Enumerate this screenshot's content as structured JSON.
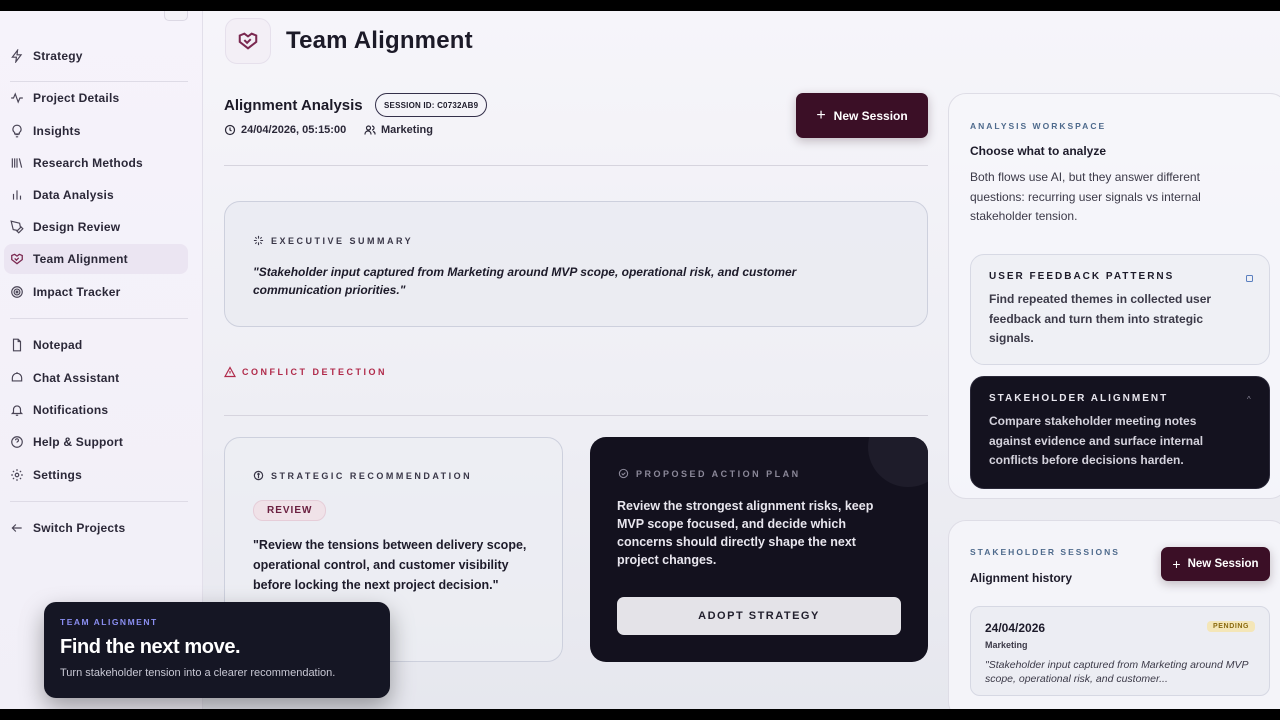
{
  "sidebar": {
    "items": [
      {
        "label": "Strategy",
        "icon": "lightning-icon"
      },
      {
        "label": "Project Details",
        "icon": "activity-icon"
      },
      {
        "label": "Insights",
        "icon": "lightbulb-icon"
      },
      {
        "label": "Research Methods",
        "icon": "library-icon"
      },
      {
        "label": "Data Analysis",
        "icon": "bar-chart-icon"
      },
      {
        "label": "Design Review",
        "icon": "pen-tool-icon"
      },
      {
        "label": "Team Alignment",
        "icon": "handshake-icon",
        "active": true
      },
      {
        "label": "Impact Tracker",
        "icon": "target-icon"
      },
      {
        "label": "Notepad",
        "icon": "file-icon"
      },
      {
        "label": "Chat Assistant",
        "icon": "chat-bot-icon"
      },
      {
        "label": "Notifications",
        "icon": "bell-icon"
      },
      {
        "label": "Help & Support",
        "icon": "help-circle-icon"
      },
      {
        "label": "Settings",
        "icon": "gear-icon"
      },
      {
        "label": "Switch Projects",
        "icon": "arrow-left-icon"
      }
    ]
  },
  "header": {
    "title": "Team Alignment",
    "icon": "handshake-icon"
  },
  "analysis": {
    "title": "Alignment Analysis",
    "session_id": "SESSION ID: C0732AB9",
    "datetime": "24/04/2026, 05:15:00",
    "team": "Marketing",
    "new_session_label": "New Session"
  },
  "summary": {
    "kicker": "EXECUTIVE SUMMARY",
    "text": "\"Stakeholder input captured from Marketing around MVP scope, operational risk, and customer communication priorities.\""
  },
  "conflict": {
    "label": "CONFLICT DETECTION"
  },
  "recommendation": {
    "kicker": "STRATEGIC RECOMMENDATION",
    "badge": "REVIEW",
    "text": "\"Review the tensions between delivery scope, operational control, and customer visibility before locking the next project decision.\""
  },
  "action_plan": {
    "kicker": "PROPOSED ACTION PLAN",
    "text": "Review the strongest alignment risks, keep MVP scope focused, and decide which concerns should directly shape the next project changes.",
    "button_label": "ADOPT STRATEGY"
  },
  "workspace": {
    "kicker": "ANALYSIS WORKSPACE",
    "title": "Choose what to analyze",
    "description": "Both flows use AI, but they answer different questions: recurring user signals vs internal stakeholder tension.",
    "options": [
      {
        "title": "USER FEEDBACK PATTERNS",
        "description": "Find repeated themes in collected user feedback and turn them into strategic signals."
      },
      {
        "title": "STAKEHOLDER ALIGNMENT",
        "description": "Compare stakeholder meeting notes against evidence and surface internal conflicts before decisions harden."
      }
    ]
  },
  "sessions": {
    "kicker": "STAKEHOLDER SESSIONS",
    "title": "Alignment history",
    "new_session_label": "New Session",
    "items": [
      {
        "date": "24/04/2026",
        "status": "PENDING",
        "team": "Marketing",
        "text": "\"Stakeholder input captured from Marketing around MVP scope, operational risk, and customer..."
      }
    ]
  },
  "toast": {
    "kicker": "TEAM ALIGNMENT",
    "title": "Find the next move.",
    "description": "Turn stakeholder tension into a clearer recommendation."
  },
  "colors": {
    "accent": "#3b0f26",
    "active_icon": "#7a2850",
    "conflict": "#b02a4a",
    "dark_card": "#13111e",
    "pending_badge": "#f4e6b8"
  }
}
